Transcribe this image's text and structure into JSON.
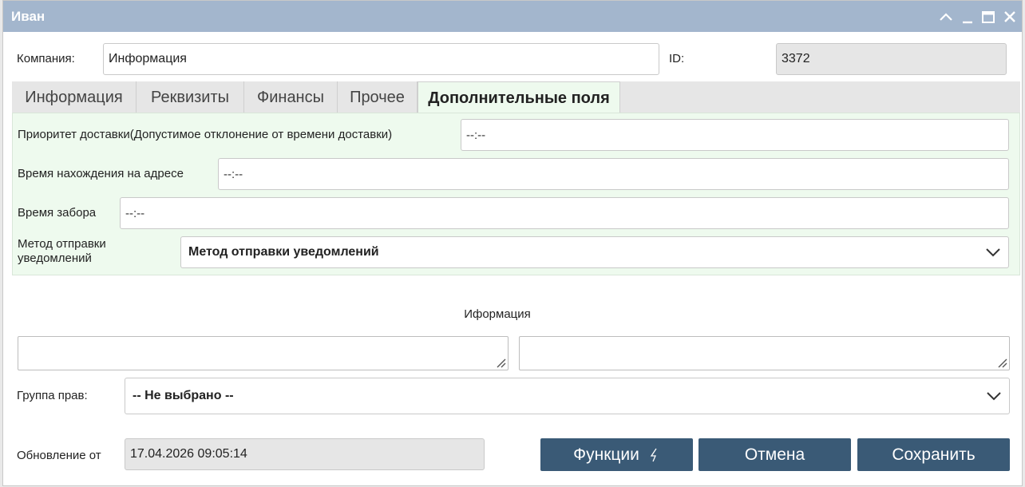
{
  "window": {
    "title": "Иван"
  },
  "header": {
    "company_label": "Компания:",
    "company_value": "Информация",
    "id_label": "ID:",
    "id_value": "3372"
  },
  "tabs": [
    {
      "label": "Информация"
    },
    {
      "label": "Реквизиты"
    },
    {
      "label": "Финансы"
    },
    {
      "label": "Прочее"
    },
    {
      "label": "Дополнительные поля",
      "active": true
    }
  ],
  "extra_fields": {
    "priority_label": "Приоритет доставки(Допустимое отклонение от времени доставки)",
    "priority_value": "--:--",
    "stay_label": "Время нахождения на адресе",
    "stay_value": "--:--",
    "pickup_label": "Время забора",
    "pickup_value": "--:--",
    "notify_label": "Метод отправки уведомлений",
    "notify_value": "Метод отправки уведомлений"
  },
  "info": {
    "heading": "Иформация"
  },
  "rights": {
    "label": "Группа прав:",
    "value": "-- Не выбрано --"
  },
  "footer": {
    "updated_label": "Обновление от",
    "updated_value": "17.04.2026 09:05:14",
    "functions_label": "Функции",
    "cancel_label": "Отмена",
    "save_label": "Сохранить"
  },
  "colors": {
    "titlebar": "#a3b6cd",
    "button": "#3a5a76",
    "panel": "#eefaee"
  }
}
